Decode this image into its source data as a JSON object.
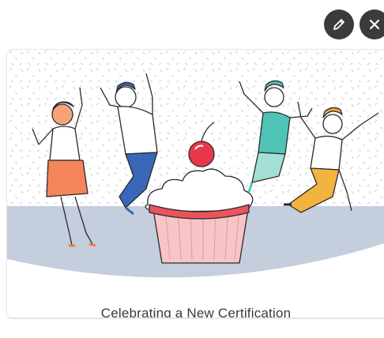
{
  "toolbar": {
    "edit_icon": "pencil-icon",
    "close_icon": "close-icon"
  },
  "card": {
    "caption": "Celebrating a New Certification",
    "illustration_subject": "people celebrating around a cupcake with a cherry"
  },
  "colors": {
    "button_bg": "#3b3b3b",
    "floor": "#c5cedd",
    "cupcake_base": "#f7c5c6",
    "cherry": "#e8374b",
    "frosting_top": "#e9545d"
  }
}
